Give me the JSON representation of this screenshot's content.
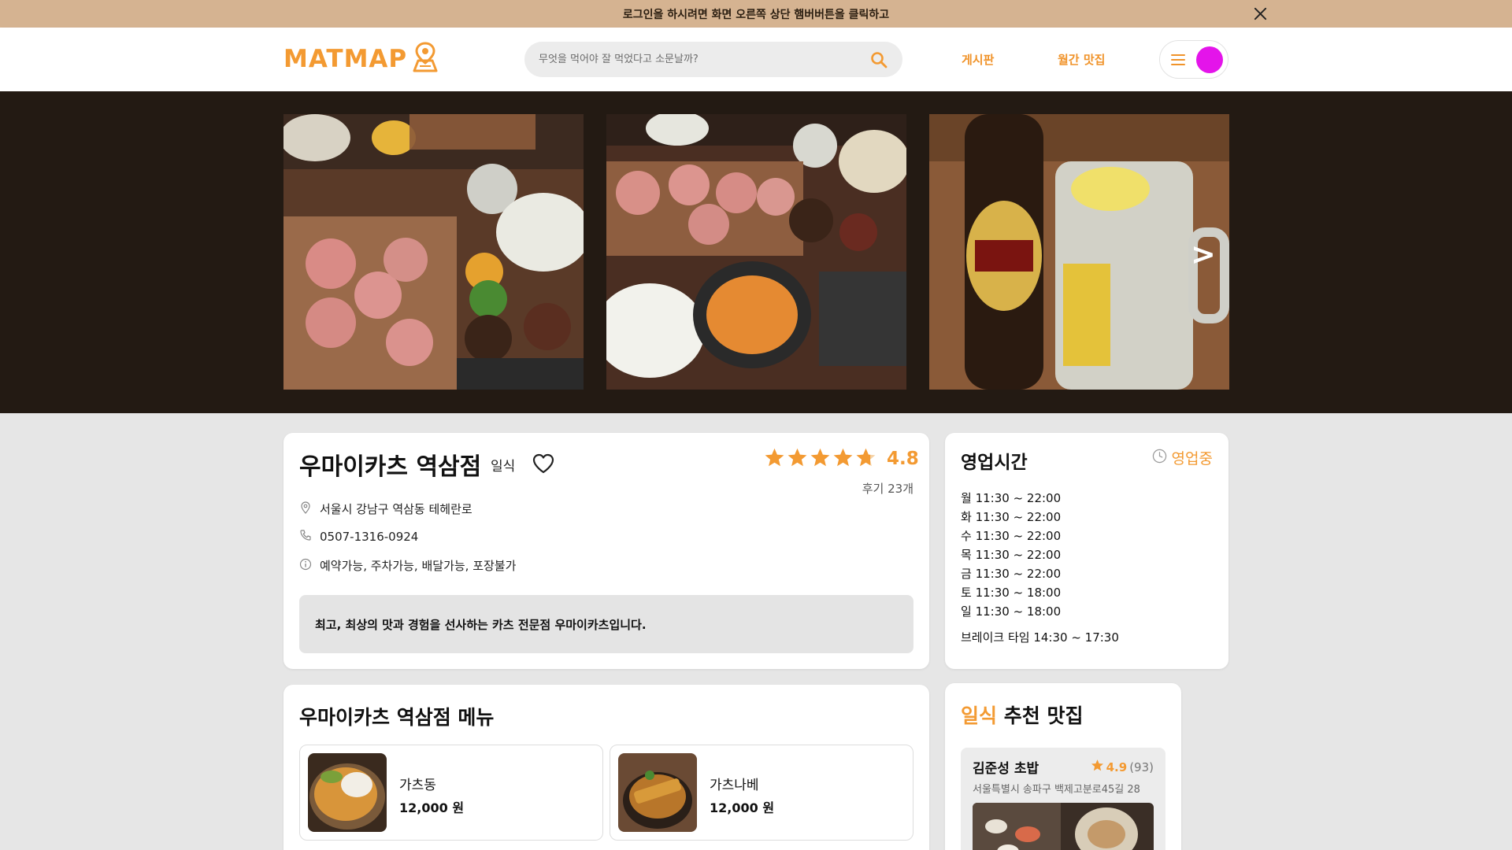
{
  "banner": {
    "text": "로그인을 하시려면 화면 오른쪽 상단 햄버버튼을 클릭하고",
    "close_icon": "close-icon"
  },
  "header": {
    "logo": "MATMAP",
    "search": {
      "placeholder": "무엇을 먹어야 잘 먹었다고 소문날까?",
      "value": ""
    },
    "nav": {
      "board": "게시판",
      "monthly": "월간 맛집"
    }
  },
  "gallery": {
    "next_label": ">"
  },
  "shop": {
    "name": "우마이카츠 역삼점",
    "category": "일식",
    "rating": "4.8",
    "stars": 4.8,
    "reviews": "후기 23개",
    "address": "서울시 강남구 역삼동 테헤란로",
    "phone": "0507-1316-0924",
    "options": "예약가능, 주차가능, 배달가능, 포장불가",
    "description": "최고, 최상의 맛과 경험을 선사하는 카츠 전문점 우마이카츠입니다."
  },
  "hours": {
    "title": "영업시간",
    "status": "영업중",
    "days": [
      "월 11:30 ~ 22:00",
      "화 11:30 ~ 22:00",
      "수 11:30 ~ 22:00",
      "목 11:30 ~ 22:00",
      "금 11:30 ~ 22:00",
      "토 11:30 ~ 18:00",
      "일 11:30 ~ 18:00"
    ],
    "break": "브레이크 타임 14:30 ~ 17:30"
  },
  "menu": {
    "title": "우마이카츠 역삼점 메뉴",
    "items": [
      {
        "name": "가츠동",
        "price": "12,000 원"
      },
      {
        "name": "가츠나베",
        "price": "12,000 원"
      }
    ]
  },
  "recommend": {
    "accent": "일식",
    "title": "추천 맛집",
    "items": [
      {
        "name": "김준성 초밥",
        "score": "4.9",
        "count": "(93)",
        "address": "서울특별시 송파구 백제고분로45길 28"
      }
    ]
  },
  "colors": {
    "accent": "#f39a32",
    "banner": "#d5b391",
    "gallery_bg": "#231a13",
    "avatar": "#e414ea"
  }
}
